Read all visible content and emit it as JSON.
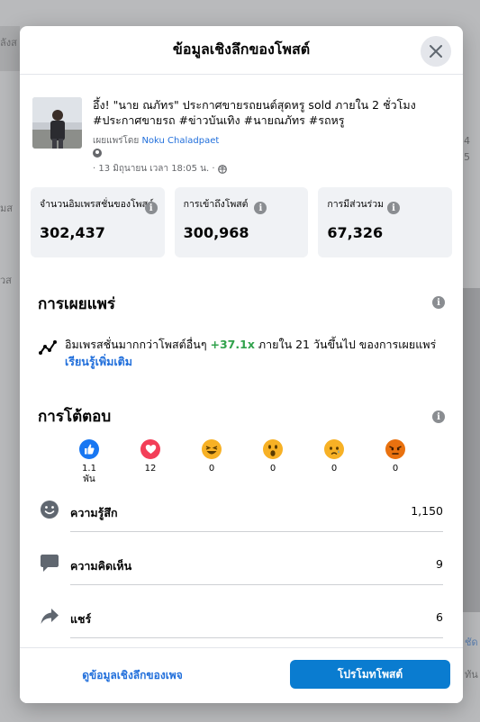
{
  "background": {
    "left_texts": [
      "ลังส",
      "มส",
      "วส"
    ],
    "right_texts": [
      "4",
      "5",
      "ชัด",
      "ทัน"
    ]
  },
  "modal": {
    "title": "ข้อมูลเชิงลึกของโพสต์",
    "close_icon": "close-icon"
  },
  "post": {
    "text": "อึ้ง! \"นาย ณภัทร\" ประกาศขายรถยนต์สุดหรู sold ภายใน 2 ชั่วโมง #ประกาศขายรถ #ข่าวบันเทิง #นายณภัทร #รถหรู",
    "published_by_prefix": "เผยแพร่โดย ",
    "author": "Noku Chaladpaet",
    "date": "· 13 มิถุนายน เวลา 18:05 น. ·"
  },
  "stats": [
    {
      "label": "จำนวนอิมเพรสชั่นของโพสต์",
      "value": "302,437"
    },
    {
      "label": "การเข้าถึงโพสต์",
      "value": "300,968"
    },
    {
      "label": "การมีส่วนร่วม",
      "value": "67,326"
    }
  ],
  "distribution": {
    "title": "การเผยแพร่",
    "text_before": "อิมเพรสชั่นมากกว่าโพสต์อื่นๆ ",
    "delta": "+37.1x",
    "text_after": " ภายใน 21 วันขึ้นไป ของการเผยแพร่ ",
    "learn_more": "เรียนรู้เพิ่มเติม"
  },
  "engagement": {
    "title": "การโต้ตอบ",
    "reactions": [
      {
        "icon": "like-icon",
        "count": "1.1\nพัน",
        "color": "#1877f2"
      },
      {
        "icon": "love-icon",
        "count": "12",
        "color": "#f33e58"
      },
      {
        "icon": "haha-icon",
        "count": "0",
        "color": "#f7b125"
      },
      {
        "icon": "wow-icon",
        "count": "0",
        "color": "#f7b125"
      },
      {
        "icon": "sad-icon",
        "count": "0",
        "color": "#f7b125"
      },
      {
        "icon": "angry-icon",
        "count": "0",
        "color": "#e9710f"
      }
    ],
    "metrics": [
      {
        "icon": "reactions-face-icon",
        "label": "ความรู้สึก",
        "value": "1,150"
      },
      {
        "icon": "comment-icon",
        "label": "ความคิดเห็น",
        "value": "9"
      },
      {
        "icon": "share-icon",
        "label": "แชร์",
        "value": "6"
      }
    ]
  },
  "footer": {
    "page_insights_link": "ดูข้อมูลเชิงลึกของเพจ",
    "promote_button": "โปรโมทโพสต์"
  }
}
